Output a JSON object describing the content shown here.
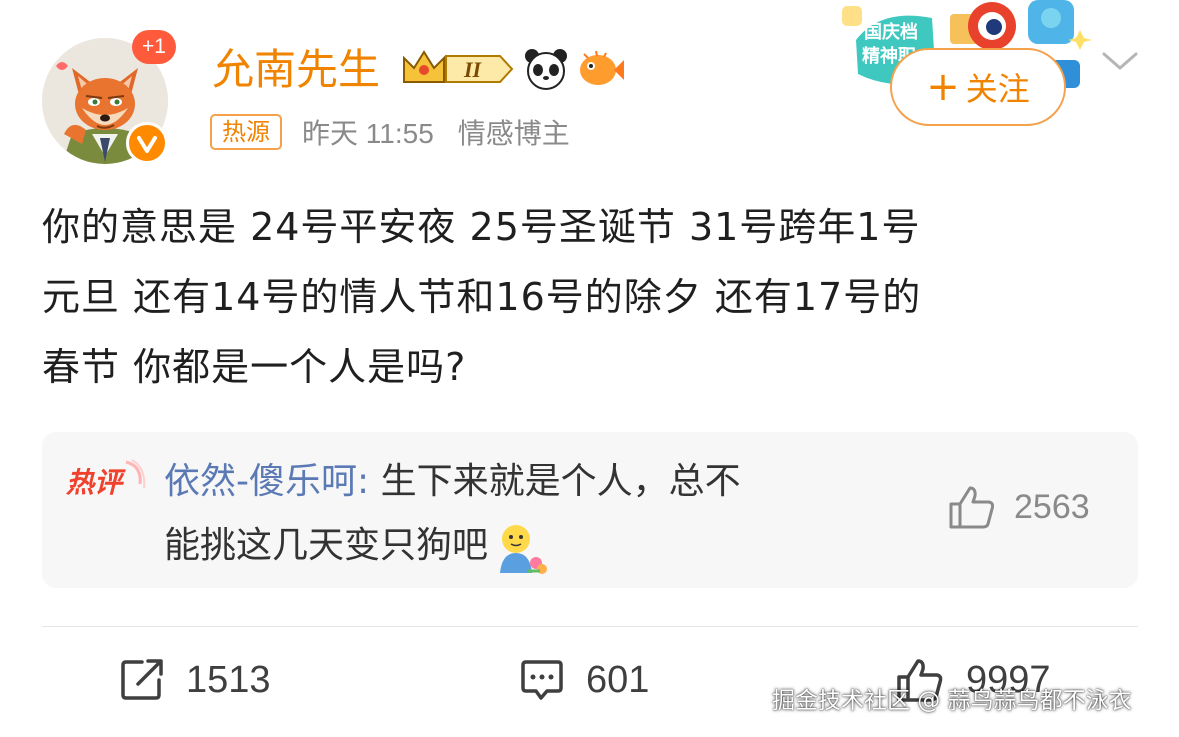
{
  "header": {
    "avatar_badge": "+1",
    "username": "允南先生",
    "badges": [
      "crown-level-II-icon",
      "panda-icon",
      "puffer-fish-icon"
    ],
    "crown_level": "II",
    "hot_tag": "热源",
    "time": "昨天 11:55",
    "role": "情感博主",
    "holiday_deco_text_1": "国庆档",
    "holiday_deco_text_2": "精神职",
    "follow_label": "关注",
    "follow_plus": "+"
  },
  "post": {
    "lines": [
      "你的意思是 24号平安夜  25号圣诞节  31号跨年1号",
      "元旦  还有14号的情人节和16号的除夕  还有17号的",
      "春节  你都是一个人是吗?"
    ]
  },
  "hot_comment": {
    "label": "热评",
    "user": "依然-傻乐呵",
    "separator": ":",
    "line1": " 生下来就是个人，总不",
    "line2": "能挑这几天变只狗吧",
    "emoji": "gardener-emoji-icon",
    "likes": "2563"
  },
  "actions": {
    "repost_count": "1513",
    "comment_count": "601",
    "like_count": "9997"
  },
  "watermark": "掘金技术社区 @ 蒜鸟蒜鸟都不泳衣",
  "colors": {
    "orange": "#f08300",
    "link_blue": "#5b7ab5",
    "gray_text": "#8a8a8a",
    "body_text": "#1f1f1f",
    "comment_bg": "#f7f7f7"
  }
}
